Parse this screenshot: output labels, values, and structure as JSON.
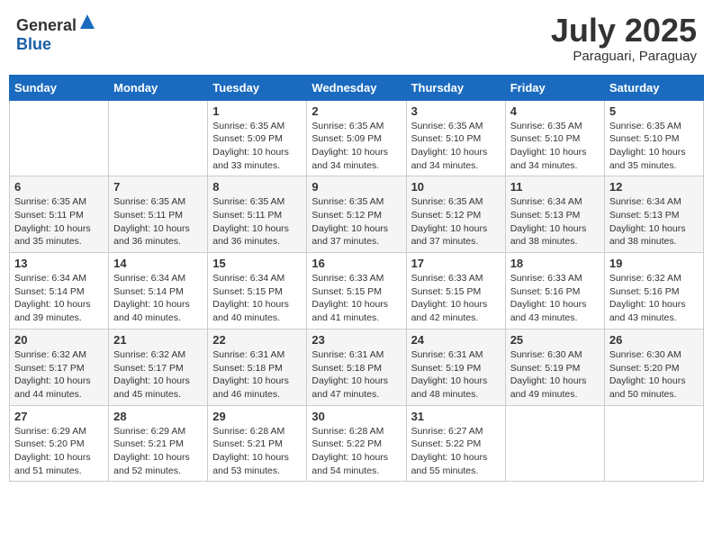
{
  "header": {
    "logo_general": "General",
    "logo_blue": "Blue",
    "month_title": "July 2025",
    "location": "Paraguari, Paraguay"
  },
  "days_of_week": [
    "Sunday",
    "Monday",
    "Tuesday",
    "Wednesday",
    "Thursday",
    "Friday",
    "Saturday"
  ],
  "weeks": [
    [
      {
        "day": "",
        "info": ""
      },
      {
        "day": "",
        "info": ""
      },
      {
        "day": "1",
        "info": "Sunrise: 6:35 AM\nSunset: 5:09 PM\nDaylight: 10 hours and 33 minutes."
      },
      {
        "day": "2",
        "info": "Sunrise: 6:35 AM\nSunset: 5:09 PM\nDaylight: 10 hours and 34 minutes."
      },
      {
        "day": "3",
        "info": "Sunrise: 6:35 AM\nSunset: 5:10 PM\nDaylight: 10 hours and 34 minutes."
      },
      {
        "day": "4",
        "info": "Sunrise: 6:35 AM\nSunset: 5:10 PM\nDaylight: 10 hours and 34 minutes."
      },
      {
        "day": "5",
        "info": "Sunrise: 6:35 AM\nSunset: 5:10 PM\nDaylight: 10 hours and 35 minutes."
      }
    ],
    [
      {
        "day": "6",
        "info": "Sunrise: 6:35 AM\nSunset: 5:11 PM\nDaylight: 10 hours and 35 minutes."
      },
      {
        "day": "7",
        "info": "Sunrise: 6:35 AM\nSunset: 5:11 PM\nDaylight: 10 hours and 36 minutes."
      },
      {
        "day": "8",
        "info": "Sunrise: 6:35 AM\nSunset: 5:11 PM\nDaylight: 10 hours and 36 minutes."
      },
      {
        "day": "9",
        "info": "Sunrise: 6:35 AM\nSunset: 5:12 PM\nDaylight: 10 hours and 37 minutes."
      },
      {
        "day": "10",
        "info": "Sunrise: 6:35 AM\nSunset: 5:12 PM\nDaylight: 10 hours and 37 minutes."
      },
      {
        "day": "11",
        "info": "Sunrise: 6:34 AM\nSunset: 5:13 PM\nDaylight: 10 hours and 38 minutes."
      },
      {
        "day": "12",
        "info": "Sunrise: 6:34 AM\nSunset: 5:13 PM\nDaylight: 10 hours and 38 minutes."
      }
    ],
    [
      {
        "day": "13",
        "info": "Sunrise: 6:34 AM\nSunset: 5:14 PM\nDaylight: 10 hours and 39 minutes."
      },
      {
        "day": "14",
        "info": "Sunrise: 6:34 AM\nSunset: 5:14 PM\nDaylight: 10 hours and 40 minutes."
      },
      {
        "day": "15",
        "info": "Sunrise: 6:34 AM\nSunset: 5:15 PM\nDaylight: 10 hours and 40 minutes."
      },
      {
        "day": "16",
        "info": "Sunrise: 6:33 AM\nSunset: 5:15 PM\nDaylight: 10 hours and 41 minutes."
      },
      {
        "day": "17",
        "info": "Sunrise: 6:33 AM\nSunset: 5:15 PM\nDaylight: 10 hours and 42 minutes."
      },
      {
        "day": "18",
        "info": "Sunrise: 6:33 AM\nSunset: 5:16 PM\nDaylight: 10 hours and 43 minutes."
      },
      {
        "day": "19",
        "info": "Sunrise: 6:32 AM\nSunset: 5:16 PM\nDaylight: 10 hours and 43 minutes."
      }
    ],
    [
      {
        "day": "20",
        "info": "Sunrise: 6:32 AM\nSunset: 5:17 PM\nDaylight: 10 hours and 44 minutes."
      },
      {
        "day": "21",
        "info": "Sunrise: 6:32 AM\nSunset: 5:17 PM\nDaylight: 10 hours and 45 minutes."
      },
      {
        "day": "22",
        "info": "Sunrise: 6:31 AM\nSunset: 5:18 PM\nDaylight: 10 hours and 46 minutes."
      },
      {
        "day": "23",
        "info": "Sunrise: 6:31 AM\nSunset: 5:18 PM\nDaylight: 10 hours and 47 minutes."
      },
      {
        "day": "24",
        "info": "Sunrise: 6:31 AM\nSunset: 5:19 PM\nDaylight: 10 hours and 48 minutes."
      },
      {
        "day": "25",
        "info": "Sunrise: 6:30 AM\nSunset: 5:19 PM\nDaylight: 10 hours and 49 minutes."
      },
      {
        "day": "26",
        "info": "Sunrise: 6:30 AM\nSunset: 5:20 PM\nDaylight: 10 hours and 50 minutes."
      }
    ],
    [
      {
        "day": "27",
        "info": "Sunrise: 6:29 AM\nSunset: 5:20 PM\nDaylight: 10 hours and 51 minutes."
      },
      {
        "day": "28",
        "info": "Sunrise: 6:29 AM\nSunset: 5:21 PM\nDaylight: 10 hours and 52 minutes."
      },
      {
        "day": "29",
        "info": "Sunrise: 6:28 AM\nSunset: 5:21 PM\nDaylight: 10 hours and 53 minutes."
      },
      {
        "day": "30",
        "info": "Sunrise: 6:28 AM\nSunset: 5:22 PM\nDaylight: 10 hours and 54 minutes."
      },
      {
        "day": "31",
        "info": "Sunrise: 6:27 AM\nSunset: 5:22 PM\nDaylight: 10 hours and 55 minutes."
      },
      {
        "day": "",
        "info": ""
      },
      {
        "day": "",
        "info": ""
      }
    ]
  ]
}
